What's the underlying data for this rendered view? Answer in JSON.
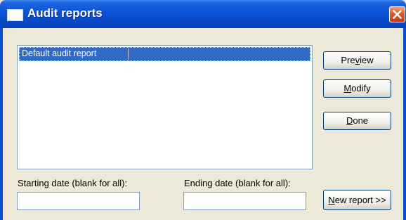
{
  "window": {
    "title": "Audit reports"
  },
  "report_list": {
    "items": [
      {
        "label": "Default audit report",
        "selected": true
      }
    ]
  },
  "buttons": {
    "preview": {
      "before": "Pre",
      "key": "v",
      "after": "iew"
    },
    "modify": {
      "before": "",
      "key": "M",
      "after": "odify"
    },
    "done": {
      "before": "",
      "key": "D",
      "after": "one"
    },
    "new_report": {
      "before": "",
      "key": "N",
      "after": "ew report >>"
    }
  },
  "date_filter": {
    "start_label": "Starting date (blank for all):",
    "start_value": "",
    "end_label": "Ending date (blank for all):",
    "end_value": ""
  },
  "colors": {
    "selection": "#316ac5",
    "titlebar": "#0a53d6",
    "close_button": "#e2562c",
    "dialog_bg": "#ece9d8"
  },
  "icons": {
    "title": "window-icon",
    "close": "close-x-icon"
  }
}
